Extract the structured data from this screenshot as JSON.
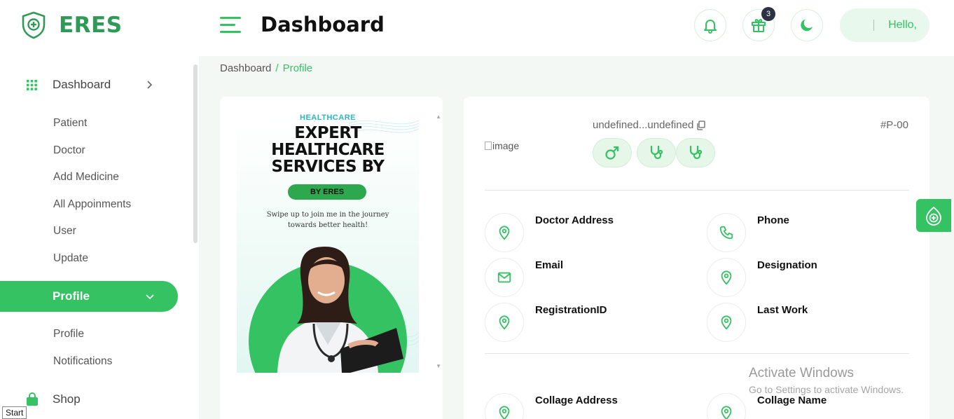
{
  "app": {
    "name": "ERES"
  },
  "header": {
    "title": "Dashboard",
    "gift_badge_count": "3",
    "greeting": "Hello,"
  },
  "sidebar": {
    "dashboard": "Dashboard",
    "dashboard_items": [
      "Patient",
      "Doctor",
      "Add Medicine",
      "All Appoinments",
      "User",
      "Update"
    ],
    "profile": "Profile",
    "profile_items": [
      "Profile",
      "Notifications"
    ],
    "shop": "Shop"
  },
  "breadcrumb": {
    "root": "Dashboard",
    "separator": "/",
    "current": "Profile"
  },
  "promo": {
    "tag": "HEALTHCARE",
    "title_lines": [
      "EXPERT",
      "HEALTHCARE",
      "SERVICES BY"
    ],
    "button": "BY ERES",
    "sub_lines": [
      "Swipe up to join me in the journey",
      "towards better health!"
    ]
  },
  "profile": {
    "image_alt": "image",
    "name": "undefined...undefined",
    "id": "#P-00",
    "fields": [
      {
        "label": "Doctor Address",
        "icon": "map-pin-icon"
      },
      {
        "label": "Phone",
        "icon": "phone-icon"
      },
      {
        "label": "Email",
        "icon": "mail-icon"
      },
      {
        "label": "Designation",
        "icon": "map-pin-icon"
      },
      {
        "label": "RegistrationID",
        "icon": "map-pin-icon"
      },
      {
        "label": "Last Work",
        "icon": "map-pin-icon"
      },
      {
        "label": "Collage Address",
        "icon": "map-pin-icon"
      },
      {
        "label": "Collage Name",
        "icon": "map-pin-icon"
      }
    ]
  },
  "watermark": {
    "line1": "Activate Windows",
    "line2": "Go to Settings to activate Windows."
  },
  "taskbar": {
    "start": "Start"
  },
  "colors": {
    "accent": "#34c263",
    "brand": "#2f9a55",
    "content_bg": "#f4f8f4"
  }
}
